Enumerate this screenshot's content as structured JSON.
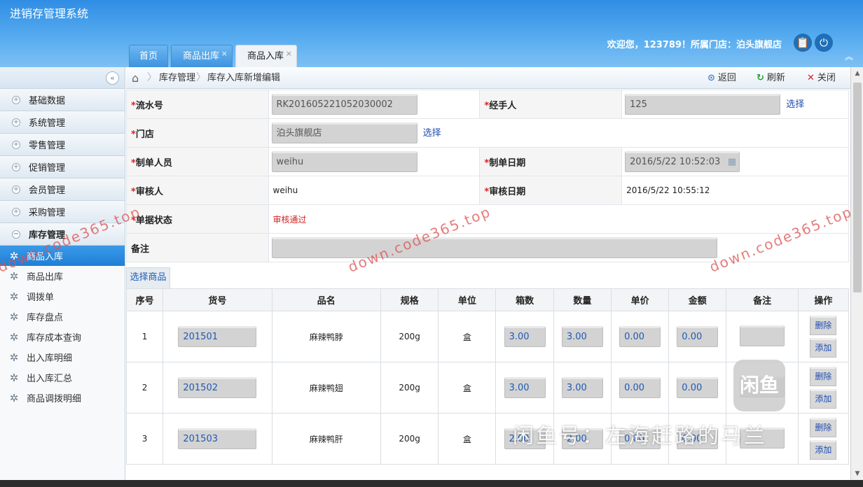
{
  "app": {
    "title": "进销存管理系统"
  },
  "tabs": [
    {
      "label": "首页"
    },
    {
      "label": "商品出库",
      "close": "×"
    },
    {
      "label": "商品入库",
      "close": "×"
    }
  ],
  "user": {
    "welcome": "欢迎您，123789！所属门店：泊头旗舰店"
  },
  "header_icons": {
    "clipboard": "📋",
    "power": "⏻",
    "collapse_up": "︽"
  },
  "sidebar": {
    "collapse": "«",
    "sections": [
      {
        "label": "基础数据",
        "toggle": "+"
      },
      {
        "label": "系统管理",
        "toggle": "+"
      },
      {
        "label": "零售管理",
        "toggle": "+"
      },
      {
        "label": "促销管理",
        "toggle": "+"
      },
      {
        "label": "会员管理",
        "toggle": "+"
      },
      {
        "label": "采购管理",
        "toggle": "+"
      },
      {
        "label": "库存管理",
        "toggle": "−"
      }
    ],
    "items": [
      {
        "label": "商品入库",
        "active": true
      },
      {
        "label": "商品出库"
      },
      {
        "label": "调拨单"
      },
      {
        "label": "库存盘点"
      },
      {
        "label": "库存成本查询"
      },
      {
        "label": "出入库明细"
      },
      {
        "label": "出入库汇总"
      },
      {
        "label": "商品调拨明细"
      }
    ]
  },
  "breadcrumb": {
    "home_icon": "⌂",
    "sep": "〉",
    "level1": "库存管理",
    "level2": "库存入库新增编辑"
  },
  "toolbar": {
    "back": "返回",
    "refresh": "刷新",
    "close": "关闭",
    "back_icon": "⊙",
    "refresh_icon": "↻",
    "close_icon": "✕"
  },
  "form": {
    "required_mark": "*",
    "serial_label": "流水号",
    "serial_value": "RK201605221052030002",
    "handler_label": "经手人",
    "handler_value": "125",
    "handler_pick": "选择",
    "store_label": "门店",
    "store_value": "泊头旗舰店",
    "store_pick": "选择",
    "maker_label": "制单人员",
    "maker_value": "weihu",
    "make_date_label": "制单日期",
    "make_date_value": "2016/5/22 10:52:03",
    "calendar_icon": "▦",
    "auditor_label": "审核人",
    "auditor_value": "weihu",
    "audit_date_label": "审核日期",
    "audit_date_value": "2016/5/22 10:55:12",
    "status_label": "单据状态",
    "status_value": "审核通过",
    "remark_label": "备注",
    "remark_value": ""
  },
  "pick_goods": "选择商品",
  "grid": {
    "headers": [
      "序号",
      "货号",
      "品名",
      "规格",
      "单位",
      "箱数",
      "数量",
      "单价",
      "金额",
      "备注",
      "操作"
    ],
    "delete_label": "删除",
    "add_label": "添加",
    "rows": [
      {
        "no": "1",
        "code": "201501",
        "name": "麻辣鸭脖",
        "spec": "200g",
        "unit": "盒",
        "boxes": "3.00",
        "qty": "3.00",
        "price": "0.00",
        "amount": "0.00",
        "remark": ""
      },
      {
        "no": "2",
        "code": "201502",
        "name": "麻辣鸭翅",
        "spec": "200g",
        "unit": "盒",
        "boxes": "3.00",
        "qty": "3.00",
        "price": "0.00",
        "amount": "0.00",
        "remark": ""
      },
      {
        "no": "3",
        "code": "201503",
        "name": "麻辣鸭肝",
        "spec": "200g",
        "unit": "盒",
        "boxes": "2.00",
        "qty": "2.00",
        "price": "0.00",
        "amount": "0.00",
        "remark": ""
      }
    ]
  },
  "watermarks": {
    "site": "down.code365.top",
    "fish_logo": "闲鱼",
    "fish_text": "闲鱼号：左海赶路的马兰"
  }
}
